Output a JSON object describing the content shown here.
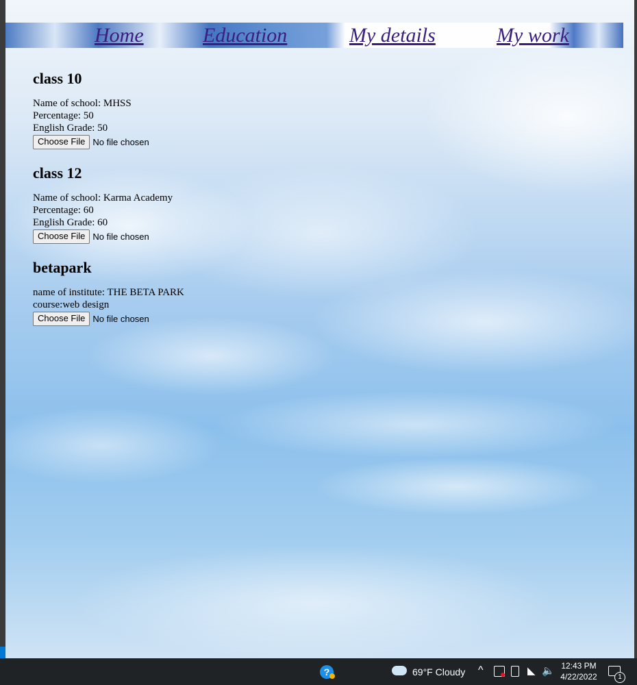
{
  "nav": {
    "home": "Home",
    "education": "Education",
    "my_details": "My details",
    "my_work": "My work"
  },
  "sections": [
    {
      "heading": "class 10",
      "lines": [
        "Name of school: MHSS",
        "Percentage: 50",
        "English Grade: 50"
      ],
      "file_button": "Choose File",
      "file_status": "No file chosen"
    },
    {
      "heading": "class 12",
      "lines": [
        "Name of school: Karma Academy",
        "Percentage: 60",
        "English Grade: 60"
      ],
      "file_button": "Choose File",
      "file_status": "No file chosen"
    },
    {
      "heading": "betapark",
      "lines": [
        "name of institute: THE BETA PARK",
        "course:web design"
      ],
      "file_button": "Choose File",
      "file_status": "No file chosen"
    }
  ],
  "taskbar": {
    "help_icon": "?",
    "weather_icon": "cloud-icon",
    "weather": "69°F  Cloudy",
    "chevron": "^",
    "time": "12:43 PM",
    "date": "4/22/2022",
    "notification_count": "1"
  },
  "colors": {
    "link": "#3a1f7e",
    "taskbar": "#1f2326",
    "accent": "#0078d4"
  }
}
